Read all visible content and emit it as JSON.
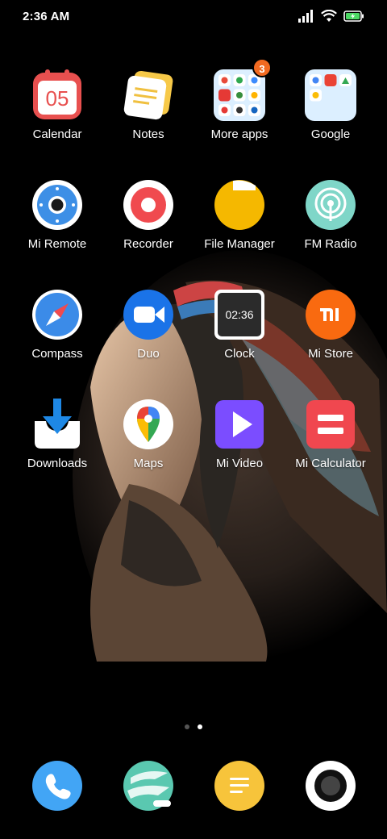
{
  "status_bar": {
    "time": "2:36 AM",
    "battery_state": "charging"
  },
  "apps": {
    "calendar": {
      "label": "Calendar",
      "day": "05"
    },
    "notes": {
      "label": "Notes"
    },
    "more_apps": {
      "label": "More apps",
      "badge": "3"
    },
    "google": {
      "label": "Google"
    },
    "mi_remote": {
      "label": "Mi Remote"
    },
    "recorder": {
      "label": "Recorder"
    },
    "file_manager": {
      "label": "File Manager"
    },
    "fm_radio": {
      "label": "FM Radio"
    },
    "compass": {
      "label": "Compass"
    },
    "duo": {
      "label": "Duo"
    },
    "clock": {
      "label": "Clock",
      "time": "02:36"
    },
    "mi_store": {
      "label": "Mi Store"
    },
    "downloads": {
      "label": "Downloads"
    },
    "maps": {
      "label": "Maps"
    },
    "mi_video": {
      "label": "Mi Video"
    },
    "mi_calculator": {
      "label": "Mi Calculator"
    }
  },
  "page_indicator": {
    "pages": 2,
    "active": 2
  },
  "dock": [
    "phone-icon",
    "gallery-icon",
    "messaging-icon",
    "camera-icon"
  ],
  "colors": {
    "accent_orange": "#f26a21",
    "calendar_red": "#e8504f",
    "file_yellow": "#f5b800",
    "video_purple": "#7b4dff",
    "calc_red": "#f0474f",
    "phone_blue": "#42a5f5"
  }
}
